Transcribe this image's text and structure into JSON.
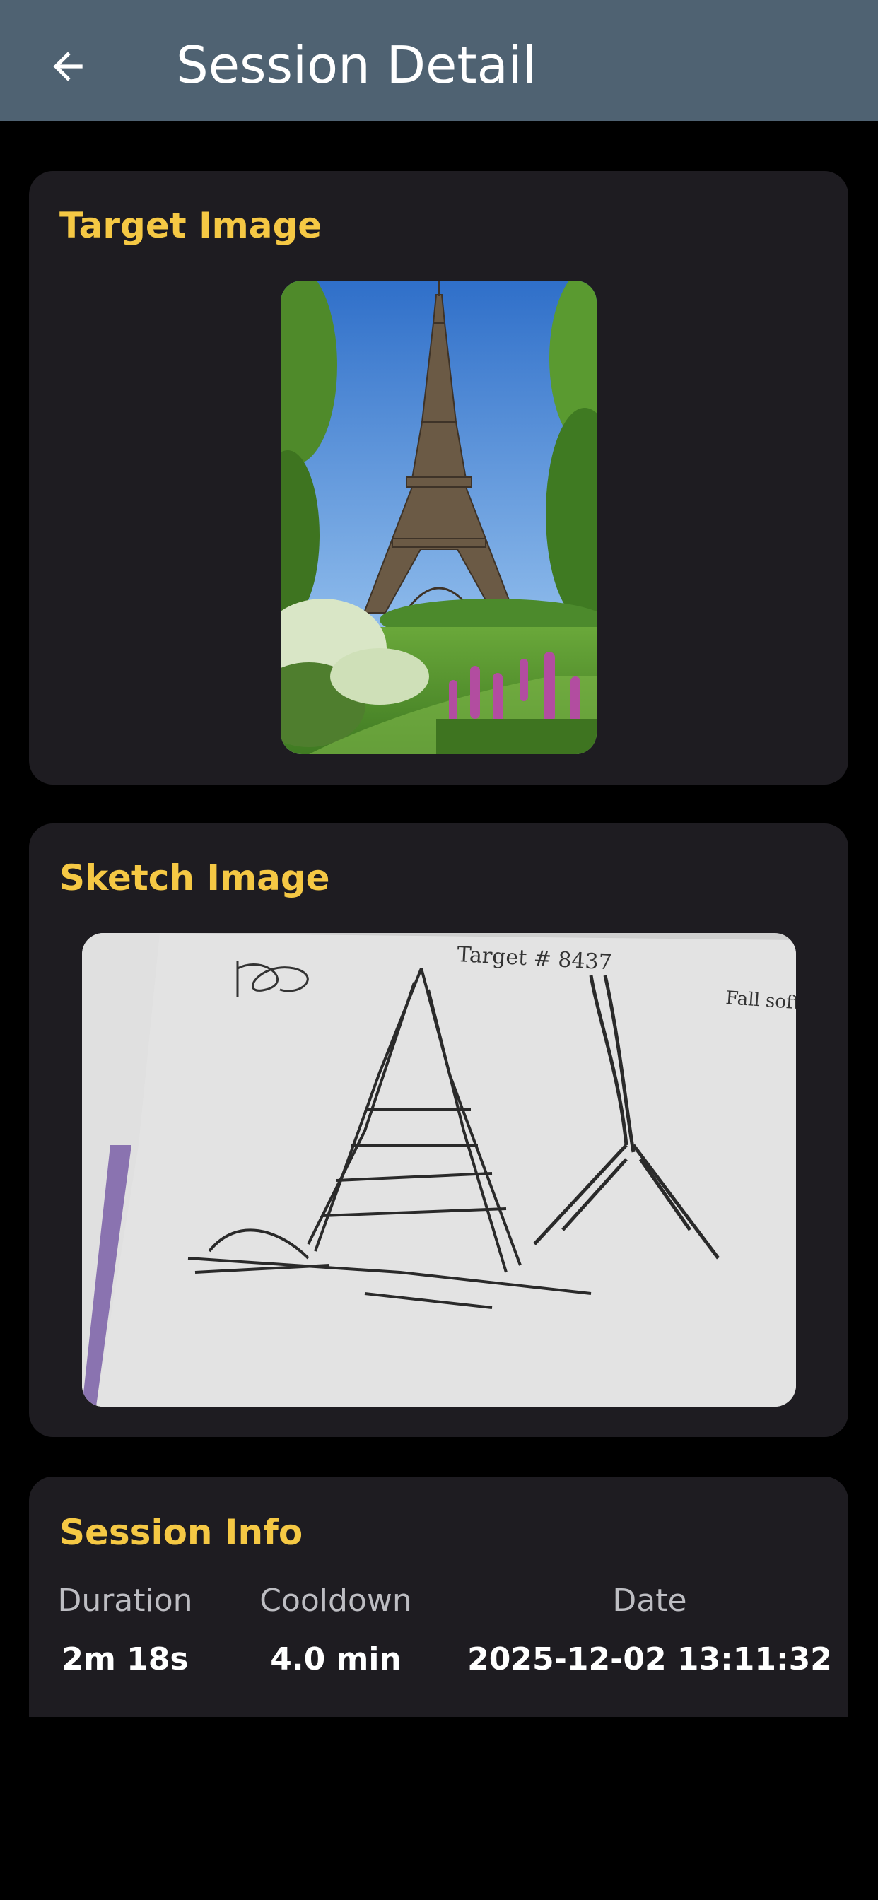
{
  "header": {
    "title": "Session Detail",
    "back_icon": "arrow-left-icon"
  },
  "target_card": {
    "title": "Target Image",
    "image_subject": "Eiffel Tower with trees and purple lupine flowers"
  },
  "sketch_card": {
    "title": "Sketch Image",
    "image_subject": "Pencil sketch of tower shapes on paper",
    "handwritten_text": "Target # 8437"
  },
  "info_card": {
    "title": "Session Info",
    "duration_label": "Duration",
    "duration_value": "2m 18s",
    "cooldown_label": "Cooldown",
    "cooldown_value": "4.0 min",
    "date_label": "Date",
    "date_value": "2025-12-02 13:11:32"
  },
  "colors": {
    "appbar": "#4f6272",
    "background": "#000000",
    "card": "#1e1c21",
    "accent": "#f5c844"
  }
}
